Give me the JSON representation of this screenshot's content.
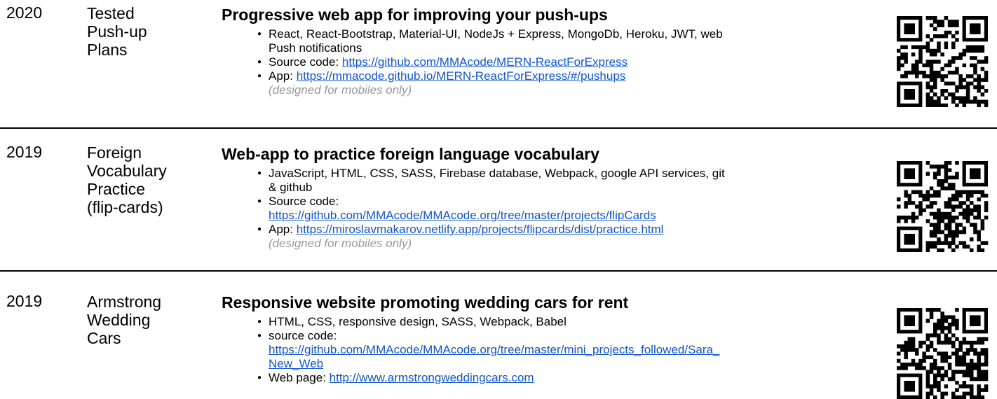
{
  "projects": [
    {
      "year": "2020",
      "name": [
        "Tested",
        "Push-up",
        "Plans"
      ],
      "title": "Progressive web app for improving your push-ups",
      "tech": [
        "React, React-Bootstrap, Material-UI, NodeJs + Express, MongoDb, Heroku, JWT, web",
        "Push notifications"
      ],
      "source_label": "Source code: ",
      "source_url": [
        "https://github.com/MMAcode/MERN-ReactForExpress"
      ],
      "app_label": "App: ",
      "app_url": "https://mmacode.github.io/MERN-ReactForExpress/#/pushups",
      "note": "(designed for mobiles only)",
      "qr_icon": "qr-code-icon"
    },
    {
      "year": "2019",
      "name": [
        "Foreign",
        "Vocabulary",
        "Practice",
        "(flip-cards)"
      ],
      "title": "Web-app to practice foreign language vocabulary",
      "tech": [
        "JavaScript, HTML, CSS, SASS, Firebase database, Webpack, google API services, git",
        "& github"
      ],
      "source_label": "Source code:",
      "source_url": [
        "https://github.com/MMAcode/MMAcode.org/tree/master/projects/flipCards"
      ],
      "app_label": "App: ",
      "app_url": "https://miroslavmakarov.netlify.app/projects/flipcards/dist/practice.html",
      "note": "(designed for mobiles only)",
      "qr_icon": "qr-code-icon"
    },
    {
      "year": "2019",
      "name": [
        "Armstrong",
        "Wedding",
        "Cars"
      ],
      "title": "Responsive website promoting wedding cars for rent",
      "tech": [
        "HTML, CSS, responsive design, SASS, Webpack, Babel"
      ],
      "source_label": "source code:",
      "source_url": [
        "https://github.com/MMAcode/MMAcode.org/tree/master/mini_projects_followed/Sara_",
        "New_Web"
      ],
      "app_label": "Web page: ",
      "app_url": "http://www.armstrongweddingcars.com",
      "qr_icon": "qr-code-icon"
    }
  ],
  "colors": {
    "link": "#1155cc",
    "note": "#999999",
    "divider": "#000000"
  }
}
